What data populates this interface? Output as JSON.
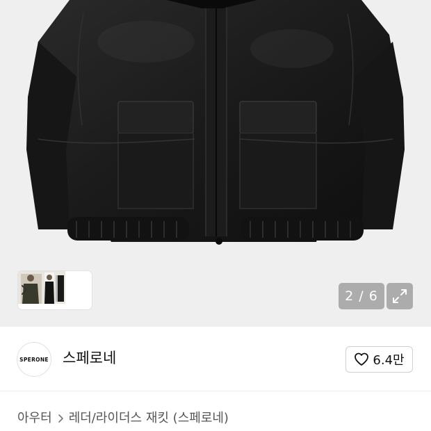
{
  "gallery": {
    "counter": "2 / 6",
    "thumbnail_icon": "chevron-right-icon",
    "expand_icon": "expand-arrows-icon"
  },
  "seller": {
    "logo_text": "SPERONE",
    "name": "스페로네",
    "like_icon": "heart-outline-icon",
    "like_count": "6.4만"
  },
  "breadcrumb": {
    "category": "아우터",
    "separator_icon": "chevron-right-icon",
    "subcategory": "레더/라이더스 재킷 (스페로네)"
  },
  "colors": {
    "hero_background": "#efefef",
    "overlay_button": "#828282",
    "text_primary": "#111111",
    "text_secondary": "#555555"
  }
}
